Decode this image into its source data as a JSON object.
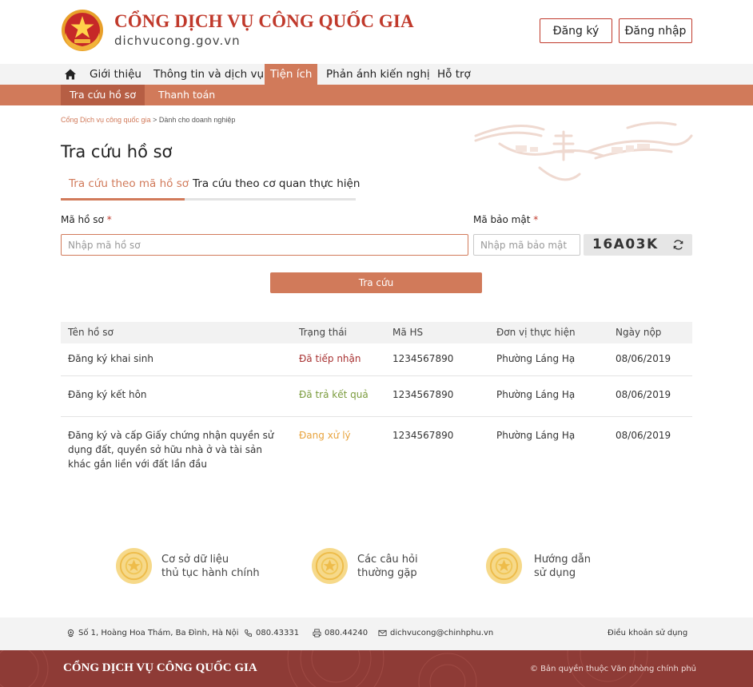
{
  "header": {
    "site_title": "CỔNG DỊCH VỤ CÔNG QUỐC GIA",
    "site_domain": "dichvucong.gov.vn",
    "register_label": "Đăng ký",
    "login_label": "Đăng nhập"
  },
  "nav": {
    "items": [
      "Giới thiệu",
      "Thông tin và dịch vụ",
      "Tiện ích",
      "Phản ánh kiến nghị",
      "Hỗ trợ"
    ],
    "active_item": "Tiện ích",
    "sub_items": [
      "Tra cứu hồ sơ",
      "Thanh toán"
    ],
    "active_sub_item": "Tra cứu hồ sơ"
  },
  "breadcrumb": {
    "root": "Cổng Dịch vụ công quốc gia",
    "separator": " > ",
    "current": "Dành cho doanh nghiệp"
  },
  "page_title": "Tra cứu hồ sơ",
  "tabs": [
    "Tra cứu theo mã hồ sơ",
    "Tra cứu theo cơ quan thực hiện"
  ],
  "form": {
    "code_label": "Mã hồ sơ",
    "code_placeholder": "Nhập mã hồ sơ",
    "captcha_label": "Mã bảo mật",
    "captcha_placeholder": "Nhập mã bảo mật",
    "captcha_value": "16A03K",
    "required_mark": "*",
    "search_label": "Tra cứu"
  },
  "table": {
    "headers": [
      "Tên hồ sơ",
      "Trạng thái",
      "Mã HS",
      "Đơn vị thực hiện",
      "Ngày nộp"
    ],
    "rows": [
      {
        "name": "Đăng ký khai sinh",
        "status": "Đã tiếp nhận",
        "code": "1234567890",
        "unit": "Phường Láng Hạ",
        "date": "08/06/2019"
      },
      {
        "name": "Đăng ký kết hôn",
        "status": "Đã trả kết quả",
        "code": "1234567890",
        "unit": "Phường Láng Hạ",
        "date": "08/06/2019"
      },
      {
        "name": "Đăng ký và cấp Giấy chứng nhận quyền sử dụng đất, quyền sở hữu nhà ở và tài sản khác gắn liền với đất lần đầu",
        "status": "Đang xử lý",
        "code": "1234567890",
        "unit": "Phường Láng Hạ",
        "date": "08/06/2019"
      }
    ]
  },
  "quick_links": [
    {
      "line1": "Cơ sở dữ liệu",
      "line2": "thủ tục hành chính"
    },
    {
      "line1": "Các câu hỏi",
      "line2": "thường gặp"
    },
    {
      "line1": "Hướng dẫn",
      "line2": "sử dụng"
    }
  ],
  "footer": {
    "address": "Số 1, Hoàng Hoa Thám, Ba Đình, Hà Nội",
    "phone": "080.43331",
    "fax": "080.44240",
    "email": "dichvucong@chinhphu.vn",
    "terms": "Điều khoản sử dụng",
    "brand": "CỔNG DỊCH VỤ CÔNG QUỐC GIA",
    "copyright": "© Bản quyền thuộc Văn phòng chính phủ"
  },
  "colors": {
    "accent": "#d17a5a",
    "brand_red": "#c0392b",
    "footer_bg": "#8e3b36",
    "status_received": "#a83232",
    "status_returned": "#7a9b3c",
    "status_processing": "#e8a33d"
  },
  "icons": [
    "national-emblem-icon",
    "home-icon",
    "refresh-icon",
    "location-icon",
    "phone-icon",
    "fax-icon",
    "email-icon",
    "medal-icon"
  ]
}
